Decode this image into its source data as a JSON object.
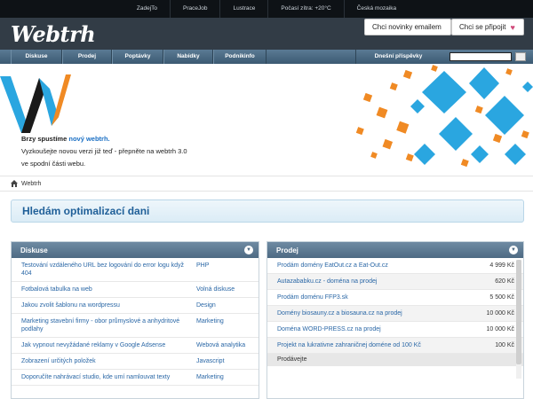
{
  "topbar": {
    "links": [
      "ZadejTo",
      "PraceJob",
      "Lustrace",
      "Počasí zítra: +20°C",
      "Česká mozaika"
    ]
  },
  "header": {
    "logo": "Webtrh",
    "news_button": "Chci novinky emailem",
    "join_button": "Chci se připojit"
  },
  "nav": {
    "items": [
      "Diskuse",
      "Prodej",
      "Poptávky",
      "Nabídky",
      "Podnikinfo"
    ],
    "today": "Dnešní příspěvky"
  },
  "banner": {
    "line1_prefix": "Brzy spustíme ",
    "line1_link": "nový webtrh.",
    "line2": "Vyzkoušejte novou verzi již teď - přepněte na webtrh 3.0 ve spodní části webu."
  },
  "breadcrumb": {
    "label": "Webtrh"
  },
  "page": {
    "title": "Hledám optimalizací dani"
  },
  "discussion": {
    "title": "Diskuse",
    "rows": [
      {
        "topic": "Testování vzdáleného URL bez logování do error logu když 404",
        "category": "PHP"
      },
      {
        "topic": "Fotbalová tabulka na web",
        "category": "Volná diskuse"
      },
      {
        "topic": "Jakou zvolit šablonu na wordpressu",
        "category": "Design"
      },
      {
        "topic": "Marketing stavební firmy - obor průmyslové a anhydritové podlahy",
        "category": "Marketing"
      },
      {
        "topic": "Jak vypnout nevyžádané reklamy v Google Adsense",
        "category": "Webová analytika"
      },
      {
        "topic": "Zobrazení určitých položek",
        "category": "Javascript"
      },
      {
        "topic": "Doporučíte nahrávací studio, kde umí namlouvat texty",
        "category": "Marketing"
      }
    ]
  },
  "sale": {
    "title": "Prodej",
    "rows": [
      {
        "item": "Prodám domény EatOut.cz a Eat-Out.cz",
        "price": "4 999 Kč"
      },
      {
        "item": "Autazababku.cz - doména na prodej",
        "price": "620 Kč"
      },
      {
        "item": "Prodám doménu FFP3.sk",
        "price": "5 500 Kč"
      },
      {
        "item": "Domény biosauny.cz a biosauna.cz na prodej",
        "price": "10 000 Kč"
      },
      {
        "item": "Doména WORD-PRESS.cz na prodej",
        "price": "10 000 Kč"
      },
      {
        "item": "Projekt na lukrativne zahraničnej doméne od 100 Kč",
        "price": "100 Kč"
      }
    ],
    "footer": "Prodávejte"
  },
  "colors": {
    "nav_blue": "#4a6a84",
    "header_dark": "#323c46",
    "link_blue": "#2a67a6",
    "title_blue": "#1f5f98",
    "accent_orange": "#f08a24",
    "accent_cyan": "#2aa6e0"
  }
}
